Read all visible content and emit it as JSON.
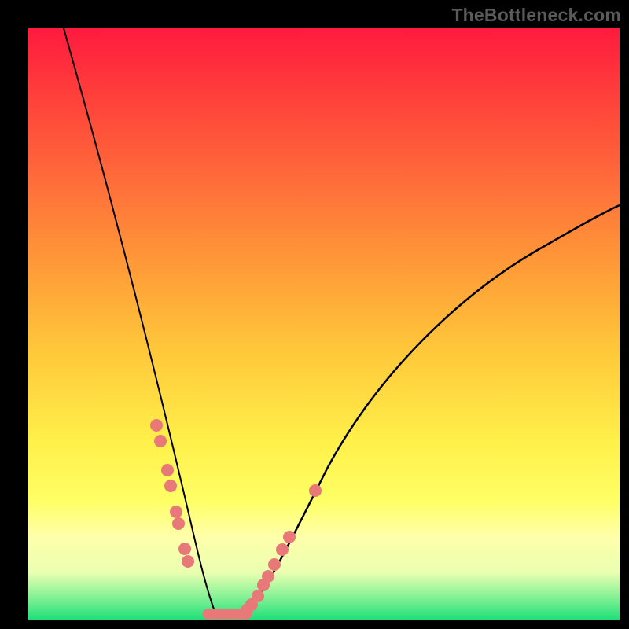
{
  "watermark": "TheBottleneck.com",
  "chart_data": {
    "type": "line",
    "title": "",
    "xlabel": "",
    "ylabel": "",
    "xlim": [
      0,
      100
    ],
    "ylim": [
      0,
      100
    ],
    "grid": false,
    "legend": false,
    "background": "red-yellow-green vertical gradient",
    "series": [
      {
        "name": "left-curve",
        "x": [
          6,
          10,
          14,
          18,
          22,
          24,
          26,
          28,
          30,
          31,
          32
        ],
        "y": [
          100,
          85,
          68,
          50,
          31,
          22,
          13,
          7,
          3,
          1,
          0
        ]
      },
      {
        "name": "right-curve",
        "x": [
          36,
          38,
          40,
          44,
          50,
          58,
          68,
          80,
          92,
          100
        ],
        "y": [
          0,
          2,
          5,
          13,
          24,
          36,
          48,
          58,
          65,
          70
        ]
      },
      {
        "name": "valley-floor",
        "x": [
          30,
          36
        ],
        "y": [
          0,
          0
        ]
      }
    ],
    "markers": {
      "left": [
        {
          "x": 21.5,
          "y": 33
        },
        {
          "x": 22.3,
          "y": 30
        },
        {
          "x": 23.5,
          "y": 25
        },
        {
          "x": 24.1,
          "y": 22
        },
        {
          "x": 25.0,
          "y": 18
        },
        {
          "x": 25.4,
          "y": 16
        },
        {
          "x": 26.5,
          "y": 12
        },
        {
          "x": 27.0,
          "y": 10
        }
      ],
      "right": [
        {
          "x": 37.0,
          "y": 1.5
        },
        {
          "x": 37.8,
          "y": 2.5
        },
        {
          "x": 38.8,
          "y": 4
        },
        {
          "x": 39.8,
          "y": 6
        },
        {
          "x": 40.6,
          "y": 7.5
        },
        {
          "x": 41.6,
          "y": 9.5
        },
        {
          "x": 43.0,
          "y": 12
        },
        {
          "x": 44.2,
          "y": 14
        },
        {
          "x": 48.5,
          "y": 22
        }
      ]
    },
    "colors": {
      "curve": "#000000",
      "markers": "#e97879",
      "gradient_top": "#ff1a3f",
      "gradient_mid": "#fff04a",
      "gradient_bottom": "#1fe07a"
    }
  }
}
